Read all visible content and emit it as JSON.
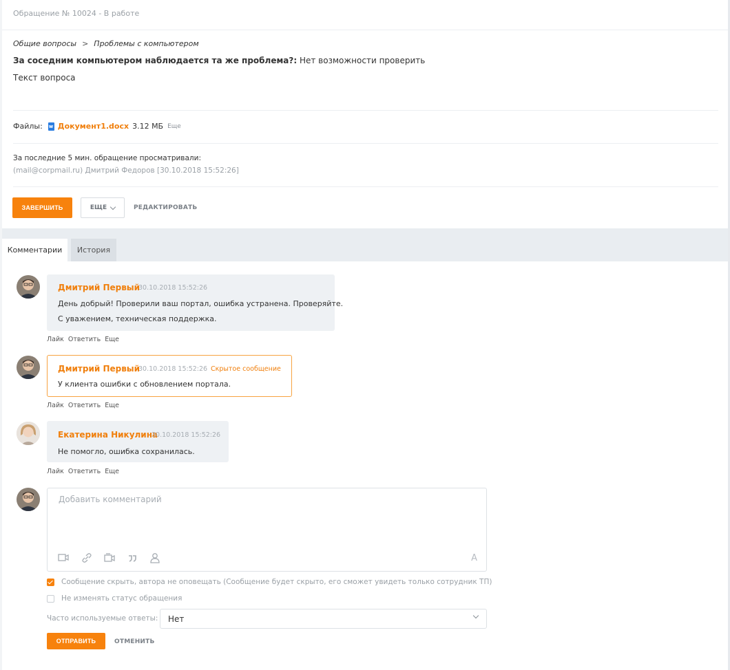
{
  "ticket": {
    "title": "Обращение № 10024 - В работе"
  },
  "breadcrumb": {
    "item1": "Общие вопросы",
    "separator": ">",
    "item2": "Проблемы с компьютером"
  },
  "question": {
    "label": "За соседним компьютером наблюдается та же проблема?:",
    "answer": "Нет возможности проверить",
    "text": "Текст вопроса"
  },
  "files": {
    "label": "Файлы:",
    "file_name": "Документ1.docx",
    "file_size": "3.12 МБ",
    "more": "Еще"
  },
  "viewers": {
    "title": "За последние 5 мин. обращение просматривали:",
    "entry": "(mail@corpmail.ru) Дмитрий Федоров [30.10.2018 15:52:26]"
  },
  "actions": {
    "complete": "ЗАВЕРШИТЬ",
    "more": "ЕЩЕ",
    "edit": "РЕДАКТИРОВАТЬ"
  },
  "tabs": [
    {
      "label": "Комментарии",
      "active": true
    },
    {
      "label": "История",
      "active": false
    }
  ],
  "comments": [
    {
      "author": "Дмитрий Первый",
      "time": "30.10.2018 15:52:26",
      "lines": [
        "День добрый! Проверили ваш портал, ошибка устранена. Проверяйте.",
        "С уважением, техническая поддержка."
      ],
      "hidden_label": "",
      "actions": [
        "Лайк",
        "Ответить",
        "Еще"
      ]
    },
    {
      "author": "Дмитрий Первый",
      "time": "30.10.2018 15:52:26",
      "lines": [
        "У клиента ошибки с обновлением портала."
      ],
      "hidden_label": "Скрытое сообщение",
      "actions": [
        "Лайк",
        "Ответить",
        "Еще"
      ]
    },
    {
      "author": "Екатерина Никулина",
      "time": "30.10.2018 15:52:26",
      "lines": [
        "Не помогло, ошибка сохранилась."
      ],
      "hidden_label": "",
      "actions": [
        "Лайк",
        "Ответить",
        "Еще"
      ]
    }
  ],
  "editor": {
    "placeholder": "Добавить комментарий",
    "toolbar_icons": [
      "image-video-icon",
      "link-icon",
      "video-icon",
      "quote-icon",
      "mention-user-icon"
    ],
    "font_button": "A"
  },
  "options": {
    "hide_message": "Сообщение скрыть, автора не оповещать (Сообщение будет скрыто, его сможет увидеть только сотрудник ТП)",
    "hide_message_checked": true,
    "keep_status": "Не изменять статус обращения",
    "keep_status_checked": false
  },
  "frequent": {
    "label": "Часто используемые ответы:",
    "value": "Нет"
  },
  "form_actions": {
    "send": "ОТПРАВИТЬ",
    "cancel": "ОТМЕНИТЬ"
  },
  "colors": {
    "accent": "#f7820d",
    "author": "#f07f0c",
    "bubble": "#eef1f4",
    "tabs_bar": "#e9edf1"
  }
}
